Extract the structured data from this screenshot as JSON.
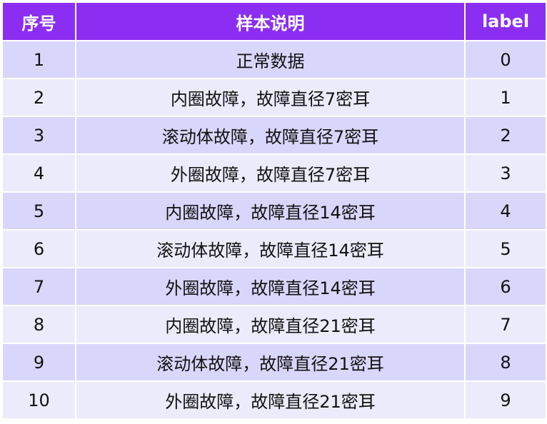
{
  "table": {
    "headers": [
      "序号",
      "样本说明",
      "label"
    ],
    "rows": [
      [
        "1",
        "正常数据",
        "0"
      ],
      [
        "2",
        "内圈故障，故障直径7密耳",
        "1"
      ],
      [
        "3",
        "滚动体故障，故障直径7密耳",
        "2"
      ],
      [
        "4",
        "外圈故障，故障直径7密耳",
        "3"
      ],
      [
        "5",
        "内圈故障，故障直径14密耳",
        "4"
      ],
      [
        "6",
        "滚动体故障，故障直径14密耳",
        "5"
      ],
      [
        "7",
        "外圈故障，故障直径14密耳",
        "6"
      ],
      [
        "8",
        "内圈故障，故障直径21密耳",
        "7"
      ],
      [
        "9",
        "滚动体故障，故障直径21密耳",
        "8"
      ],
      [
        "10",
        "外圈故障，故障直径21密耳",
        "9"
      ]
    ]
  },
  "colors": {
    "header_bg": "#8b2ef2",
    "row_odd_bg": "#d9d6fb",
    "row_even_bg": "#ecebfc"
  }
}
